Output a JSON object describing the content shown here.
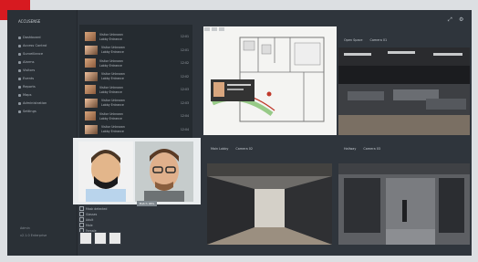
{
  "colors": {
    "accent_red": "#d71a20",
    "window_bg": "#2f353c",
    "sidebar_bg": "#2a3036"
  },
  "sidebar": {
    "title": "ACCUSENSE",
    "items": [
      {
        "label": "Dashboard",
        "icon": "dashboard-icon"
      },
      {
        "label": "Access Control",
        "icon": "door-icon"
      },
      {
        "label": "Surveillance",
        "icon": "camera-icon"
      },
      {
        "label": "Alarms",
        "icon": "bell-icon"
      },
      {
        "label": "Visitors",
        "icon": "user-icon"
      },
      {
        "label": "Events",
        "icon": "calendar-icon"
      },
      {
        "label": "Reports",
        "icon": "report-icon"
      },
      {
        "label": "Maps",
        "icon": "map-icon"
      },
      {
        "label": "Administration",
        "icon": "gear-icon"
      },
      {
        "label": "Settings",
        "icon": "settings-icon"
      }
    ],
    "footer": [
      "Admin",
      "v2.1.0 Enterprise"
    ]
  },
  "face_events": [
    {
      "name": "Visitor Unknown",
      "time": "12:01",
      "detail": "Lobby Entrance"
    },
    {
      "name": "Visitor Unknown",
      "time": "12:01",
      "detail": "Lobby Entrance"
    },
    {
      "name": "Visitor Unknown",
      "time": "12:02",
      "detail": "Lobby Entrance"
    },
    {
      "name": "Visitor Unknown",
      "time": "12:02",
      "detail": "Lobby Entrance"
    },
    {
      "name": "Visitor Unknown",
      "time": "12:03",
      "detail": "Lobby Entrance"
    },
    {
      "name": "Visitor Unknown",
      "time": "12:03",
      "detail": "Lobby Entrance"
    },
    {
      "name": "Visitor Unknown",
      "time": "12:04",
      "detail": "Lobby Entrance"
    },
    {
      "name": "Visitor Unknown",
      "time": "12:04",
      "detail": "Lobby Entrance"
    }
  ],
  "cameras": [
    {
      "title": "Open Space",
      "sub": "Camera 01"
    },
    {
      "title": "Main Lobby",
      "sub": "Camera 02"
    },
    {
      "title": "Hallway",
      "sub": "Camera 03"
    }
  ],
  "face_match": {
    "label": "Match 96%",
    "checks": [
      "Mask detected",
      "Glasses",
      "Adult",
      "Male",
      "Female"
    ]
  }
}
